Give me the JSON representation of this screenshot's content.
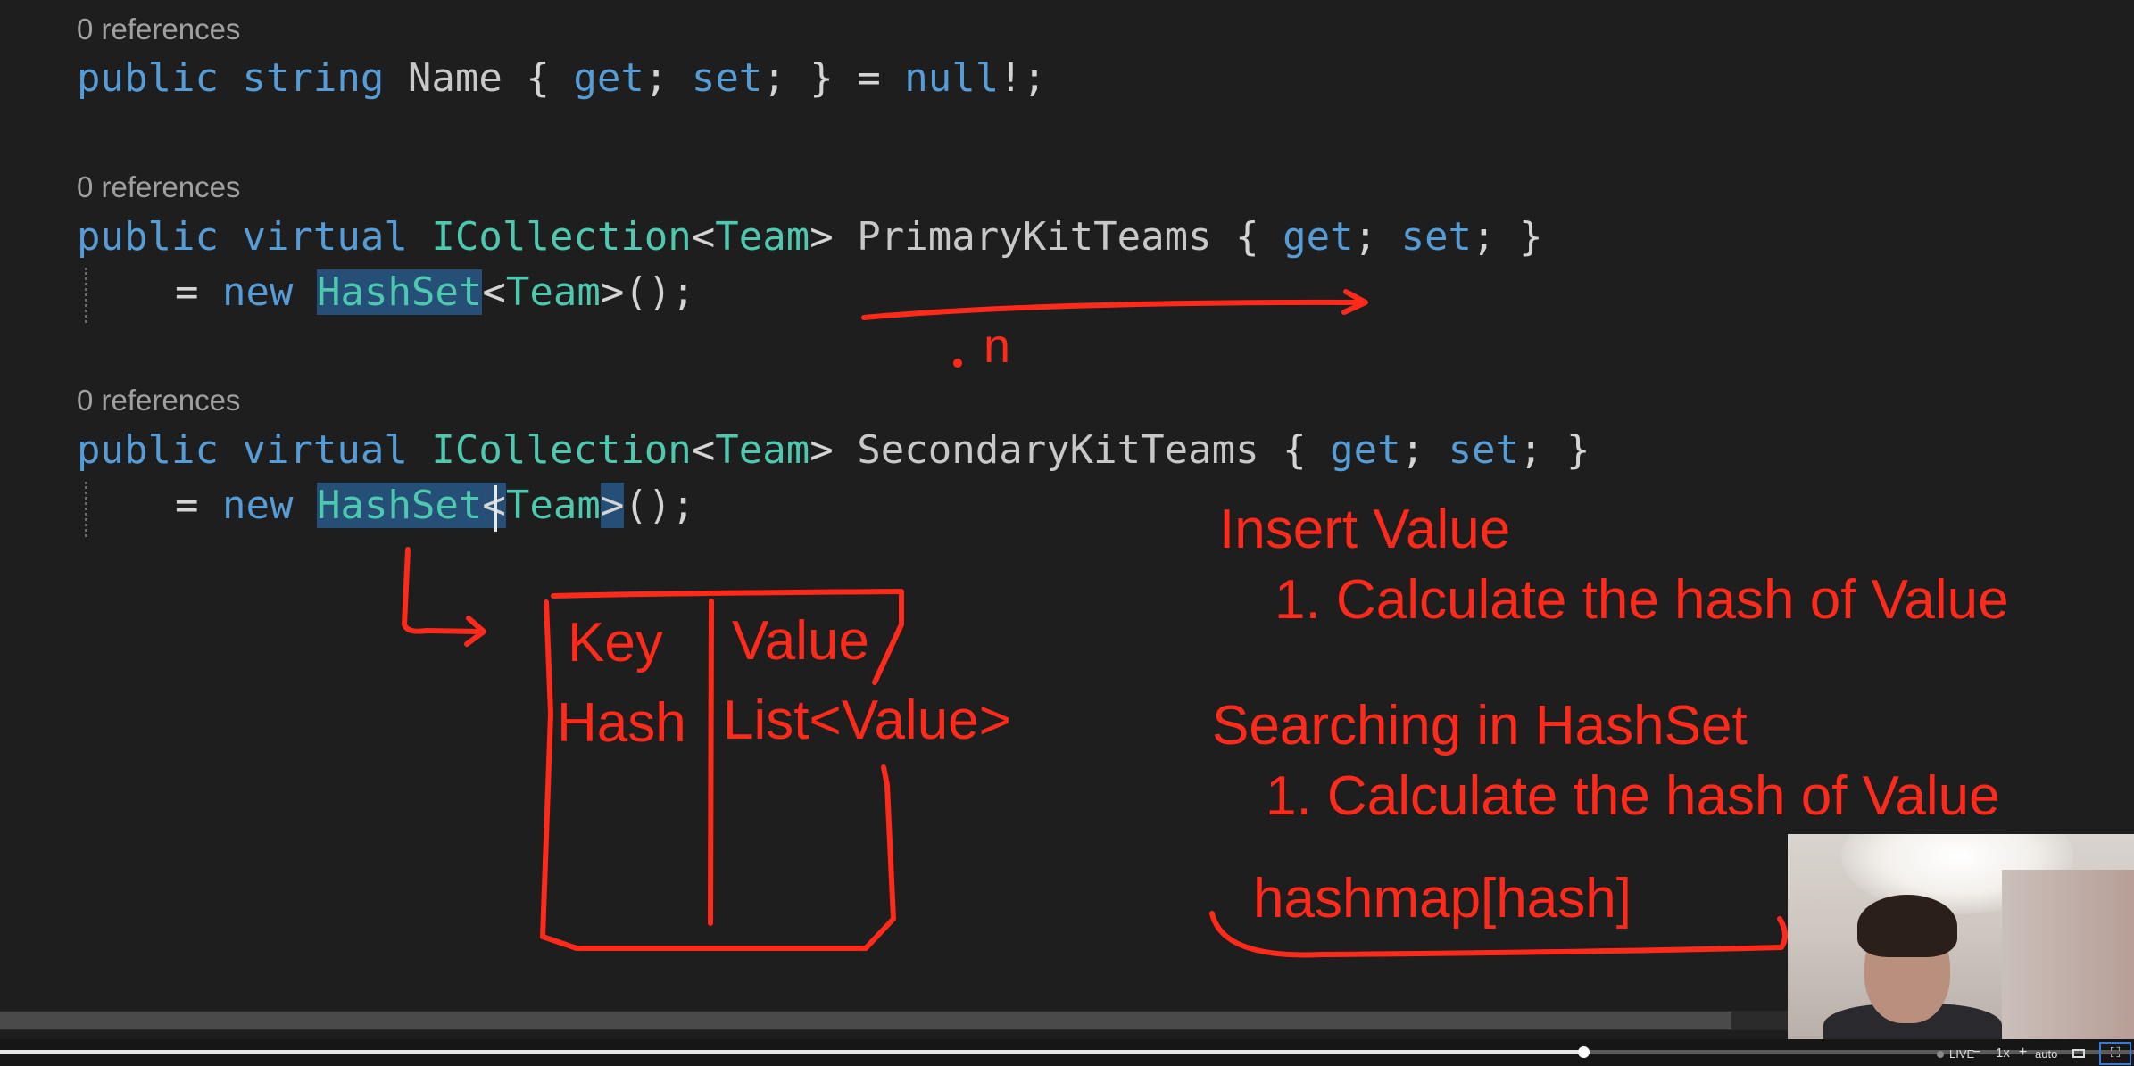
{
  "editor": {
    "blocks": [
      {
        "codelens": "0 references",
        "line1": {
          "kw1": "public",
          "ty1": "string",
          "prop": "Name",
          "ob": " { ",
          "get": "get",
          "semi1": "; ",
          "set": "set",
          "semi2": "; } = ",
          "null": "null",
          "end": "!;"
        }
      },
      {
        "codelens": "0 references",
        "line1": {
          "kw1": "public",
          "kw2": "virtual",
          "ty1": "ICollection",
          "lt": "<",
          "ty2": "Team",
          "gt": ">",
          "prop": "PrimaryKitTeams",
          "ob": " { ",
          "get": "get",
          "semi1": "; ",
          "set": "set",
          "semi2": "; }"
        },
        "line2": {
          "eq": "= ",
          "new": "new",
          "hs": "HashSet",
          "lt": "<",
          "ty": "Team",
          "gt": ">",
          "end": "();"
        }
      },
      {
        "codelens": "0 references",
        "line1": {
          "kw1": "public",
          "kw2": "virtual",
          "ty1": "ICollection",
          "lt": "<",
          "ty2": "Team",
          "gt": ">",
          "prop": "SecondaryKitTeams",
          "ob": " { ",
          "get": "get",
          "semi1": "; ",
          "set": "set",
          "semi2": "; }"
        },
        "line2": {
          "eq": "= ",
          "new": "new",
          "hs": "HashSet",
          "lt": "<",
          "ty": "Team",
          "gt": ">",
          "end": "();"
        }
      }
    ]
  },
  "annotations": {
    "arrow_label": "n",
    "table_key": "Key",
    "table_value": "Value",
    "table_hash": "Hash",
    "table_list": "List<Value>",
    "insert_title": "Insert Value",
    "insert_step": "1. Calculate the hash of Value",
    "search_title": "Searching in HashSet",
    "search_step": "1. Calculate the hash of Value",
    "hashmap": "hashmap[hash]",
    "ink_color": "#ff2a1a"
  },
  "player": {
    "live_label": "LIVE",
    "speed": "1x",
    "quality": "auto",
    "progress": 0.742,
    "icons": [
      "live-dot-icon",
      "volume-minus-icon",
      "volume-plus-icon",
      "pip-icon",
      "fullscreen-icon"
    ]
  },
  "colors": {
    "background": "#1e1e1e",
    "keyword": "#569cd6",
    "type": "#4ec9b0",
    "property": "#c8c8c8",
    "accessor": "#9cdcfe",
    "selection": "#264f78"
  }
}
